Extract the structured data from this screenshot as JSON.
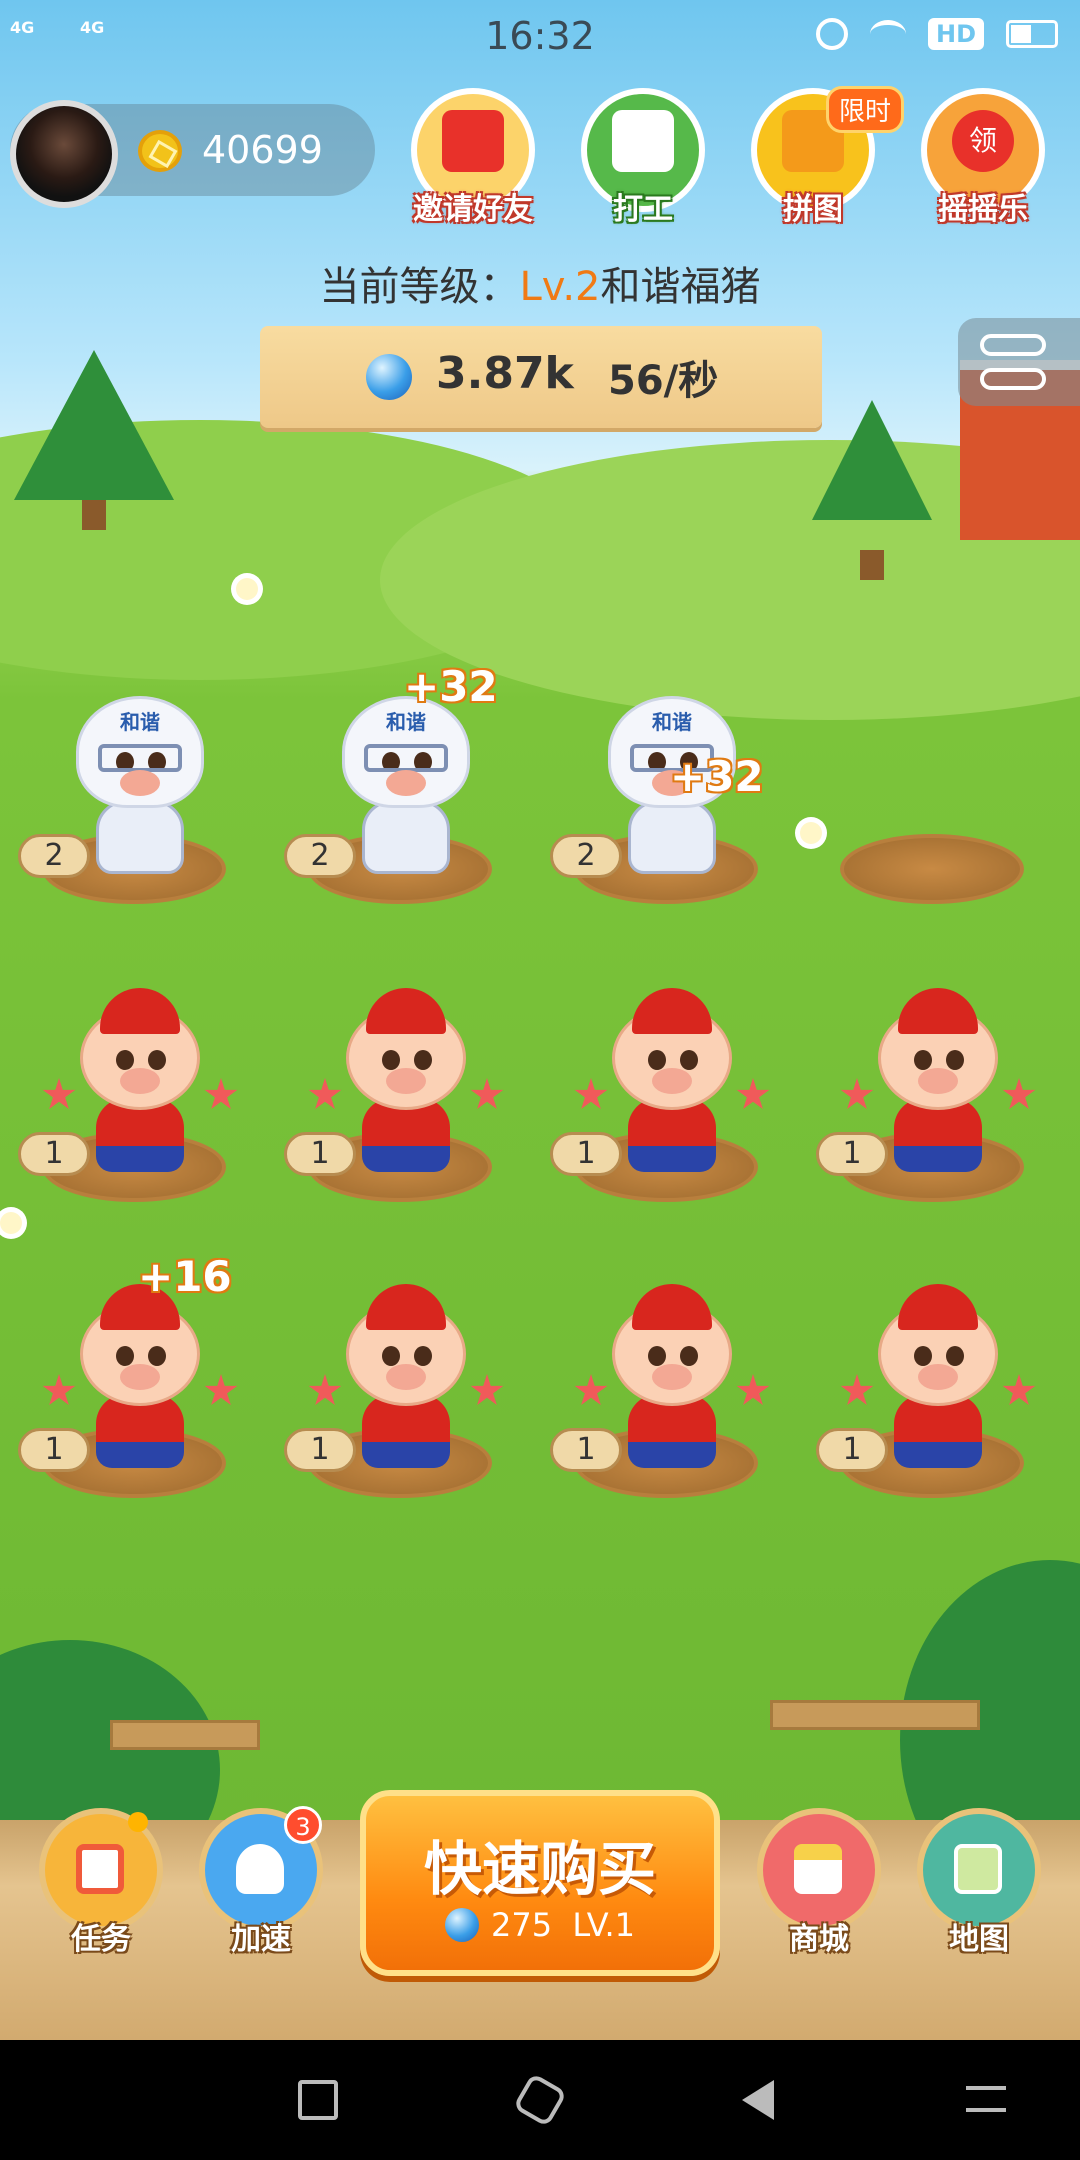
{
  "status_bar": {
    "time": "16:32",
    "signal1": "4G",
    "signal2": "4G",
    "hd": "HD",
    "icons": [
      "alarm-icon",
      "wifi-icon",
      "battery-icon"
    ]
  },
  "profile": {
    "coins": "40699"
  },
  "top_menu": [
    {
      "label": "邀请好友",
      "icon": "red-envelope-icon",
      "color": "#f25a3a"
    },
    {
      "label": "打工",
      "icon": "calendar-shovel-icon",
      "color": "#4caf3c"
    },
    {
      "label": "拼图",
      "icon": "puzzle-icon",
      "color": "#f4b41a",
      "tag": "限时"
    },
    {
      "label": "摇摇乐",
      "icon": "lucky-shake-icon",
      "color": "#f25a3a",
      "inner": "领"
    }
  ],
  "level": {
    "prefix": "当前等级：",
    "level": "Lv.2",
    "name": "和谐福猪"
  },
  "board": {
    "gems": "3.87k",
    "rate": "56/秒"
  },
  "pigs": {
    "helmet_label": "和谐",
    "plots": [
      {
        "level": "2",
        "type": "helmet"
      },
      {
        "level": "2",
        "type": "helmet"
      },
      {
        "level": "2",
        "type": "helmet"
      },
      {
        "level": "",
        "type": "empty"
      },
      {
        "level": "1",
        "type": "red"
      },
      {
        "level": "1",
        "type": "red"
      },
      {
        "level": "1",
        "type": "red"
      },
      {
        "level": "1",
        "type": "red"
      },
      {
        "level": "1",
        "type": "red"
      },
      {
        "level": "1",
        "type": "red"
      },
      {
        "level": "1",
        "type": "red"
      },
      {
        "level": "1",
        "type": "red"
      }
    ],
    "gains": [
      "+32",
      "+32",
      "+16"
    ]
  },
  "bottom_nav": {
    "tasks": {
      "label": "任务",
      "icon": "clipboard-icon"
    },
    "speed": {
      "label": "加速",
      "icon": "rocket-icon",
      "badge": "3"
    },
    "buy": {
      "label": "快速购买",
      "price": "275",
      "level": "LV.1"
    },
    "shop": {
      "label": "商城",
      "icon": "shop-icon"
    },
    "map": {
      "label": "地图",
      "icon": "map-icon"
    }
  },
  "system_nav": [
    "square-icon",
    "hexagon-home-icon",
    "back-triangle-icon",
    "notification-icon"
  ]
}
